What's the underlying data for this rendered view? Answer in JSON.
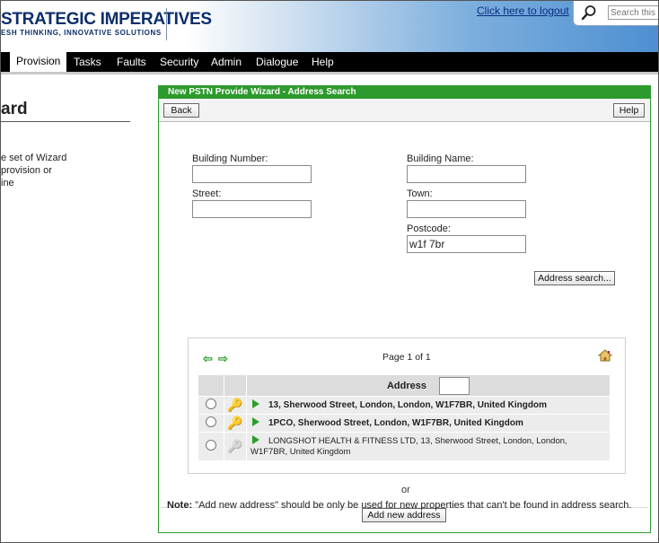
{
  "header": {
    "brand": "STRATEGIC IMPERATIVES",
    "brand_sub": "ESH THINKING, INNOVATIVE SOLUTIONS",
    "logout_link": "Click here to logout",
    "search_placeholder": "Search this p"
  },
  "nav": {
    "items": [
      {
        "label": "Provision",
        "active": true
      },
      {
        "label": "Tasks"
      },
      {
        "label": "Faults"
      },
      {
        "label": "Security"
      },
      {
        "label": "Admin"
      },
      {
        "label": "Dialogue"
      },
      {
        "label": "Help"
      }
    ]
  },
  "left": {
    "title": "ard",
    "line1": "e set of Wizard",
    "line2": "provision or",
    "line3": "ine"
  },
  "wizard": {
    "title": "New PSTN Provide Wizard - Address Search",
    "back_label": "Back",
    "help_label": "Help",
    "fields": {
      "building_number": {
        "label": "Building Number:",
        "value": ""
      },
      "building_name": {
        "label": "Building Name:",
        "value": ""
      },
      "street": {
        "label": "Street:",
        "value": ""
      },
      "town": {
        "label": "Town:",
        "value": ""
      },
      "postcode": {
        "label": "Postcode:",
        "value": "w1f 7br"
      }
    },
    "address_search_label": "Address search...",
    "results": {
      "page_text": "Page 1 of 1",
      "column_header": "Address",
      "rows": [
        {
          "text": "13, Sherwood Street, London, London, W1F7BR, United Kingdom",
          "bold": true,
          "key": "gold"
        },
        {
          "text": "1PCO, Sherwood Street, London, W1F7BR, United Kingdom",
          "bold": true,
          "key": "gold"
        },
        {
          "text_line1": "LONGSHOT HEALTH & FITNESS LTD, 13, Sherwood Street, London, London,",
          "text_line2": "W1F7BR, United Kingdom",
          "bold": false,
          "key": "grey"
        }
      ]
    },
    "or_label": "or",
    "add_new_label": "Add new address",
    "note_label": "Note:",
    "note_text": " \"Add new address\" should be only be used for new properties that can't be found in address search."
  },
  "colors": {
    "accent_green": "#2d9a2d",
    "brand_blue": "#0b2e6b",
    "nav_black": "#000000"
  }
}
